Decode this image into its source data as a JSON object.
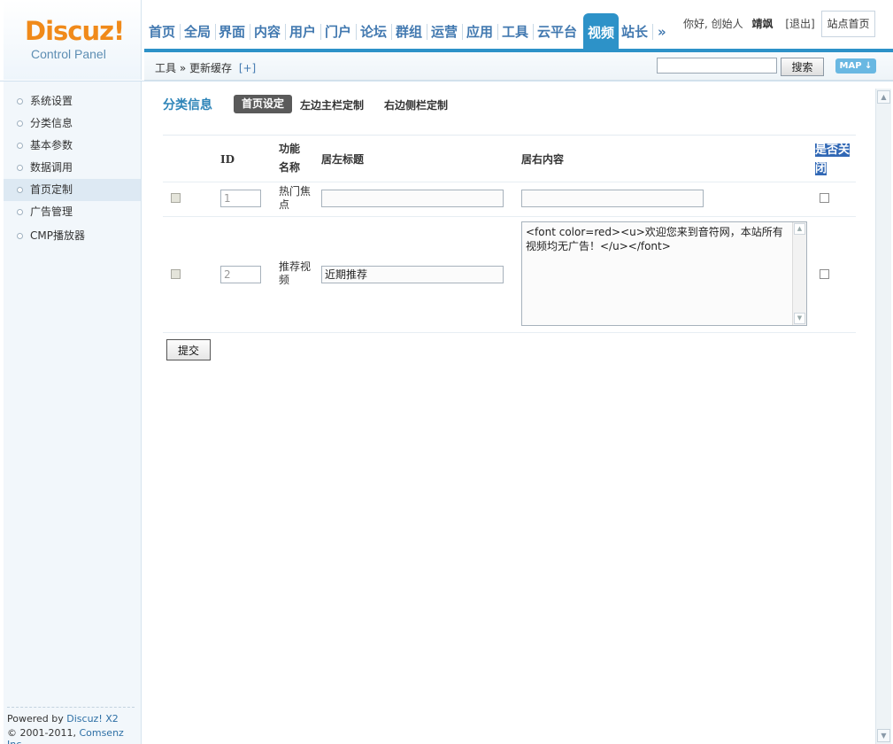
{
  "logo": {
    "word": "Discuz!",
    "sub": "Control Panel"
  },
  "nav": {
    "items": [
      "首页",
      "全局",
      "界面",
      "内容",
      "用户",
      "门户",
      "论坛",
      "群组",
      "运营",
      "应用",
      "工具",
      "云平台"
    ],
    "active": "视频",
    "after": [
      "站长",
      "»"
    ]
  },
  "user": {
    "greeting": "你好, 创始人",
    "name": "靖飒",
    "logout": "[退出]",
    "site_home": "站点首页"
  },
  "subbar": {
    "breadcrumb": "工具 » 更新缓存",
    "plus": "[+]",
    "search_btn": "搜索",
    "map_btn": "MAP ↓",
    "search_value": ""
  },
  "sidebar": {
    "items": [
      {
        "label": "系统设置",
        "active": false
      },
      {
        "label": "分类信息",
        "active": false
      },
      {
        "label": "基本参数",
        "active": false
      },
      {
        "label": "数据调用",
        "active": false
      },
      {
        "label": "首页定制",
        "active": true
      },
      {
        "label": "广告管理",
        "active": false
      },
      {
        "label": "CMP播放器",
        "active": false
      }
    ],
    "powered_prefix": "Powered by ",
    "powered_brand": "Discuz! X2",
    "copyright_prefix": "© 2001-2011, ",
    "copyright_brand": "Comsenz Inc."
  },
  "main": {
    "section_title": "分类信息",
    "tabs": {
      "home": "首页设定",
      "left": "左边主栏定制",
      "right": "右边侧栏定制"
    },
    "headers": {
      "id": "ID",
      "func": "功能名称",
      "left_title": "居左标题",
      "right_content": "居右内容",
      "close": "是否关闭"
    },
    "rows": [
      {
        "id": "1",
        "func": "热门焦点",
        "left_title": "",
        "right_content": ""
      },
      {
        "id": "2",
        "func": "推荐视频",
        "left_title": "近期推荐",
        "right_content": "<font color=red><u>欢迎您来到音符网，本站所有视频均无广告！</u></font>"
      }
    ],
    "submit": "提交"
  }
}
